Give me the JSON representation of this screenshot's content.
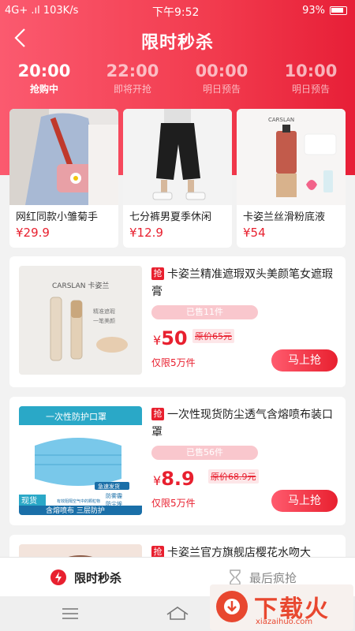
{
  "status": {
    "left": "4G+ .ıl 103K/s",
    "time": "下午9:52",
    "right": "93%"
  },
  "header": {
    "title": "限时秒杀",
    "back_icon": "chevron-left-icon"
  },
  "timeslots": [
    {
      "time": "20:00",
      "label": "抢购中",
      "active": true
    },
    {
      "time": "22:00",
      "label": "即将开抢",
      "active": false
    },
    {
      "time": "00:00",
      "label": "明日预告",
      "active": false
    },
    {
      "time": "10:00",
      "label": "明日预告",
      "active": false
    }
  ],
  "top_products": [
    {
      "name": "网红同款小雏菊手",
      "price": "¥29.9"
    },
    {
      "name": "七分裤男夏季休闲",
      "price": "¥12.9"
    },
    {
      "name": "卡姿兰丝滑粉底液",
      "price": "¥54"
    }
  ],
  "items": [
    {
      "tag": "抢",
      "title": "卡姿兰精准遮瑕双头美颜笔女遮瑕膏",
      "sold": "已售11件",
      "currency": "¥",
      "price": "50",
      "orig": "原价65元",
      "limit": "仅限5万件",
      "buy": "马上抢",
      "img_brand": "CARSLAN 卡姿兰",
      "img_note1": "精准遮瑕",
      "img_note2": "一笔美颜"
    },
    {
      "tag": "抢",
      "title": "一次性现货防尘透气含熔喷布装口罩",
      "sold": "已售56件",
      "currency": "¥",
      "price": "8.9",
      "orig": "原价68.9元",
      "limit": "仅限5万件",
      "buy": "马上抢",
      "img_head": "一次性防护口罩",
      "img_ship": "急速发货",
      "img_f1": "防雾霾",
      "img_f2": "防尘埃",
      "img_stock": "现货",
      "img_note": "有效阻隔空气中的颗粒物",
      "img_bottom": "含熔喷布  三层防护"
    },
    {
      "tag": "抢",
      "title": "卡姿兰官方旗舰店樱花水吻大"
    }
  ],
  "tabs": [
    {
      "label": "限时秒杀",
      "icon": "flash-icon",
      "active": true
    },
    {
      "label": "最后疯抢",
      "icon": "hourglass-icon",
      "active": false
    }
  ],
  "watermark": {
    "text": "下载火",
    "url": "xiazaihuo.com"
  }
}
